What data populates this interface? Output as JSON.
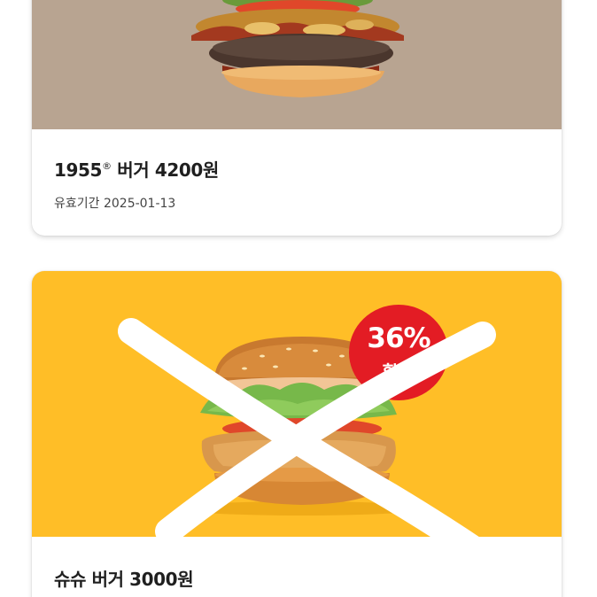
{
  "coupons": [
    {
      "title": "1955",
      "title_mark": "®",
      "title_rest": " 버거 4200원",
      "validity": "유효기간 2025-01-13",
      "image_bg": "#b8a491"
    },
    {
      "title": "슈슈 버거 3000원",
      "badge_percent": "36%",
      "badge_text": "할인",
      "image_bg": "#ffbe27",
      "crossed_out": true
    }
  ],
  "colors": {
    "badge": "#e31c24",
    "cross": "#ffffff",
    "text": "#1f1f1f"
  }
}
